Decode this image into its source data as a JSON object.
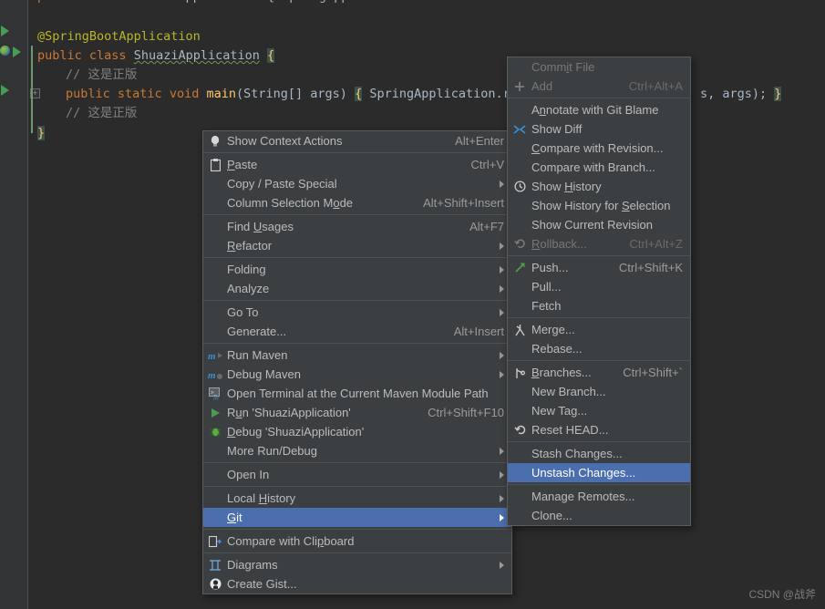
{
  "editor": {
    "clipped_top_line": "public class ShuaziApplication { SpringApplication.run",
    "lines": [
      {
        "text": "@SpringBootApplication"
      },
      {
        "text": "public class ShuaziApplication {"
      },
      {
        "text": "    // 这是正版"
      },
      {
        "text": "    public static void main(String[] args) { SpringApplication.run(ShuaziApplication.class, args); }"
      },
      {
        "text": "    // 这是正版"
      },
      {
        "text": "}"
      }
    ],
    "tokens": {
      "annotation": "@SpringBootApplication",
      "kw_public": "public",
      "kw_class": "class",
      "kw_static": "static",
      "kw_void": "void",
      "class_name": "ShuaziApplication",
      "method_name": "main",
      "params": "(String[] args)",
      "open_brace": "{",
      "close_brace": "}",
      "comment": "// 这是正版",
      "body_head": "SpringApplication.ru",
      "body_tail": "s, args);",
      "body_tail_brace": "}"
    },
    "colors": {
      "background": "#2b2b2b",
      "gutter": "#313335",
      "annotation": "#bbb529",
      "keyword": "#cc7832",
      "method": "#ffc66d",
      "comment": "#808080",
      "text": "#a9b7c6",
      "brace_highlight": "#3b514d"
    }
  },
  "context_menu": {
    "name": "editor-context-menu",
    "colors": {
      "background": "#3c3f41",
      "border": "#5a5d5e",
      "selection": "#4b6eaf"
    },
    "groups": [
      {
        "items": [
          {
            "icon": "lightbulb-icon",
            "glyph": "Ὂ1",
            "label": "Show Context Actions",
            "accel": "Alt+Enter",
            "arrow": false,
            "disabled": false,
            "selected": false,
            "name": "menu-item-show-context-actions"
          }
        ]
      },
      {
        "items": [
          {
            "icon": "clipboard-icon",
            "label": "Paste",
            "accel": "Ctrl+V",
            "arrow": false,
            "disabled": false,
            "selected": false,
            "name": "menu-item-paste"
          },
          {
            "icon": "none",
            "label": "Copy / Paste Special",
            "accel": "",
            "arrow": true,
            "disabled": false,
            "selected": false,
            "name": "menu-item-copy-paste-special"
          },
          {
            "icon": "none",
            "label": "Column Selection Mode",
            "accel": "Alt+Shift+Insert",
            "arrow": false,
            "disabled": false,
            "selected": false,
            "name": "menu-item-column-selection-mode"
          }
        ]
      },
      {
        "items": [
          {
            "icon": "none",
            "label": "Find Usages",
            "accel": "Alt+F7",
            "arrow": false,
            "disabled": false,
            "selected": false,
            "name": "menu-item-find-usages"
          },
          {
            "icon": "none",
            "label": "Refactor",
            "accel": "",
            "arrow": true,
            "disabled": false,
            "selected": false,
            "name": "menu-item-refactor"
          }
        ]
      },
      {
        "items": [
          {
            "icon": "none",
            "label": "Folding",
            "accel": "",
            "arrow": true,
            "disabled": false,
            "selected": false,
            "name": "menu-item-folding"
          },
          {
            "icon": "none",
            "label": "Analyze",
            "accel": "",
            "arrow": true,
            "disabled": false,
            "selected": false,
            "name": "menu-item-analyze"
          }
        ]
      },
      {
        "items": [
          {
            "icon": "none",
            "label": "Go To",
            "accel": "",
            "arrow": true,
            "disabled": false,
            "selected": false,
            "name": "menu-item-go-to"
          },
          {
            "icon": "none",
            "label": "Generate...",
            "accel": "Alt+Insert",
            "arrow": false,
            "disabled": false,
            "selected": false,
            "name": "menu-item-generate"
          }
        ]
      },
      {
        "items": [
          {
            "icon": "maven-run-icon",
            "label": "Run Maven",
            "accel": "",
            "arrow": true,
            "disabled": false,
            "selected": false,
            "name": "menu-item-run-maven"
          },
          {
            "icon": "maven-debug-icon",
            "label": "Debug Maven",
            "accel": "",
            "arrow": true,
            "disabled": false,
            "selected": false,
            "name": "menu-item-debug-maven"
          },
          {
            "icon": "terminal-icon",
            "label": "Open Terminal at the Current Maven Module Path",
            "accel": "",
            "arrow": false,
            "disabled": false,
            "selected": false,
            "name": "menu-item-open-terminal-maven-module"
          },
          {
            "icon": "run-icon",
            "label": "Run 'ShuaziApplication'",
            "accel": "Ctrl+Shift+F10",
            "arrow": false,
            "disabled": false,
            "selected": false,
            "name": "menu-item-run-shuaziapplication"
          },
          {
            "icon": "debug-icon",
            "label": "Debug 'ShuaziApplication'",
            "accel": "",
            "arrow": false,
            "disabled": false,
            "selected": false,
            "name": "menu-item-debug-shuaziapplication"
          },
          {
            "icon": "none",
            "label": "More Run/Debug",
            "accel": "",
            "arrow": true,
            "disabled": false,
            "selected": false,
            "name": "menu-item-more-run-debug"
          }
        ]
      },
      {
        "items": [
          {
            "icon": "none",
            "label": "Open In",
            "accel": "",
            "arrow": true,
            "disabled": false,
            "selected": false,
            "name": "menu-item-open-in"
          }
        ]
      },
      {
        "items": [
          {
            "icon": "none",
            "label": "Local History",
            "accel": "",
            "arrow": true,
            "disabled": false,
            "selected": false,
            "name": "menu-item-local-history"
          },
          {
            "icon": "none",
            "label": "Git",
            "accel": "",
            "arrow": true,
            "disabled": false,
            "selected": true,
            "name": "menu-item-git"
          }
        ]
      },
      {
        "items": [
          {
            "icon": "compare-clipboard-icon",
            "label": "Compare with Clipboard",
            "accel": "",
            "arrow": false,
            "disabled": false,
            "selected": false,
            "name": "menu-item-compare-with-clipboard"
          }
        ]
      },
      {
        "items": [
          {
            "icon": "diagram-icon",
            "label": "Diagrams",
            "accel": "",
            "arrow": true,
            "disabled": false,
            "selected": false,
            "name": "menu-item-diagrams"
          },
          {
            "icon": "github-icon",
            "label": "Create Gist...",
            "accel": "",
            "arrow": false,
            "disabled": false,
            "selected": false,
            "name": "menu-item-create-gist"
          }
        ]
      }
    ]
  },
  "git_submenu": {
    "name": "git-submenu",
    "groups": [
      {
        "items": [
          {
            "icon": "none",
            "label": "Commit File",
            "accel": "",
            "arrow": false,
            "disabled": true,
            "selected": false,
            "name": "menu-item-commit-file"
          },
          {
            "icon": "plus-icon",
            "label": "Add",
            "accel": "Ctrl+Alt+A",
            "arrow": false,
            "disabled": true,
            "selected": false,
            "name": "menu-item-add"
          }
        ]
      },
      {
        "items": [
          {
            "icon": "none",
            "label": "Annotate with Git Blame",
            "accel": "",
            "arrow": false,
            "disabled": false,
            "selected": false,
            "name": "menu-item-annotate-with-git-blame"
          },
          {
            "icon": "show-diff-icon",
            "label": "Show Diff",
            "accel": "",
            "arrow": false,
            "disabled": false,
            "selected": false,
            "name": "menu-item-show-diff"
          },
          {
            "icon": "none",
            "label": "Compare with Revision...",
            "accel": "",
            "arrow": false,
            "disabled": false,
            "selected": false,
            "name": "menu-item-compare-with-revision"
          },
          {
            "icon": "none",
            "label": "Compare with Branch...",
            "accel": "",
            "arrow": false,
            "disabled": false,
            "selected": false,
            "name": "menu-item-compare-with-branch"
          },
          {
            "icon": "clock-icon",
            "label": "Show History",
            "accel": "",
            "arrow": false,
            "disabled": false,
            "selected": false,
            "name": "menu-item-show-history"
          },
          {
            "icon": "none",
            "label": "Show History for Selection",
            "accel": "",
            "arrow": false,
            "disabled": false,
            "selected": false,
            "name": "menu-item-show-history-for-selection"
          },
          {
            "icon": "none",
            "label": "Show Current Revision",
            "accel": "",
            "arrow": false,
            "disabled": false,
            "selected": false,
            "name": "menu-item-show-current-revision"
          },
          {
            "icon": "rollback-icon",
            "label": "Rollback...",
            "accel": "Ctrl+Alt+Z",
            "arrow": false,
            "disabled": true,
            "selected": false,
            "name": "menu-item-rollback"
          }
        ]
      },
      {
        "items": [
          {
            "icon": "push-icon",
            "label": "Push...",
            "accel": "Ctrl+Shift+K",
            "arrow": false,
            "disabled": false,
            "selected": false,
            "name": "menu-item-push"
          },
          {
            "icon": "none",
            "label": "Pull...",
            "accel": "",
            "arrow": false,
            "disabled": false,
            "selected": false,
            "name": "menu-item-pull"
          },
          {
            "icon": "none",
            "label": "Fetch",
            "accel": "",
            "arrow": false,
            "disabled": false,
            "selected": false,
            "name": "menu-item-fetch"
          }
        ]
      },
      {
        "items": [
          {
            "icon": "merge-icon",
            "label": "Merge...",
            "accel": "",
            "arrow": false,
            "disabled": false,
            "selected": false,
            "name": "menu-item-merge"
          },
          {
            "icon": "none",
            "label": "Rebase...",
            "accel": "",
            "arrow": false,
            "disabled": false,
            "selected": false,
            "name": "menu-item-rebase"
          }
        ]
      },
      {
        "items": [
          {
            "icon": "branch-icon",
            "label": "Branches...",
            "accel": "Ctrl+Shift+`",
            "arrow": false,
            "disabled": false,
            "selected": false,
            "name": "menu-item-branches"
          },
          {
            "icon": "none",
            "label": "New Branch...",
            "accel": "",
            "arrow": false,
            "disabled": false,
            "selected": false,
            "name": "menu-item-new-branch"
          },
          {
            "icon": "none",
            "label": "New Tag...",
            "accel": "",
            "arrow": false,
            "disabled": false,
            "selected": false,
            "name": "menu-item-new-tag"
          },
          {
            "icon": "reset-icon",
            "label": "Reset HEAD...",
            "accel": "",
            "arrow": false,
            "disabled": false,
            "selected": false,
            "name": "menu-item-reset-head"
          }
        ]
      },
      {
        "items": [
          {
            "icon": "none",
            "label": "Stash Changes...",
            "accel": "",
            "arrow": false,
            "disabled": false,
            "selected": false,
            "name": "menu-item-stash-changes"
          },
          {
            "icon": "none",
            "label": "Unstash Changes...",
            "accel": "",
            "arrow": false,
            "disabled": false,
            "selected": true,
            "name": "menu-item-unstash-changes"
          }
        ]
      },
      {
        "items": [
          {
            "icon": "none",
            "label": "Manage Remotes...",
            "accel": "",
            "arrow": false,
            "disabled": false,
            "selected": false,
            "name": "menu-item-manage-remotes"
          },
          {
            "icon": "none",
            "label": "Clone...",
            "accel": "",
            "arrow": false,
            "disabled": false,
            "selected": false,
            "name": "menu-item-clone"
          }
        ]
      }
    ]
  },
  "watermark": {
    "text": "CSDN @战斧"
  }
}
